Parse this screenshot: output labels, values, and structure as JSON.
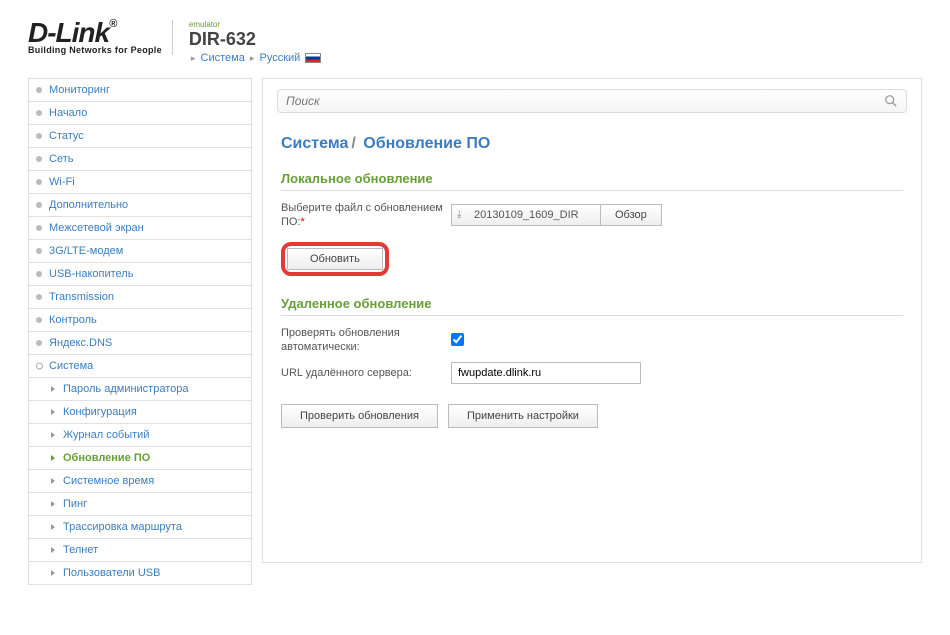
{
  "header": {
    "logo_main": "D-Link",
    "logo_sub": "Building Networks for People",
    "emulator": "emulator",
    "model": "DIR-632",
    "breadcrumb1": "Система",
    "breadcrumb2": "Русский"
  },
  "search": {
    "placeholder": "Поиск"
  },
  "nav": {
    "monitoring": "Мониторинг",
    "start": "Начало",
    "status": "Статус",
    "network": "Сеть",
    "wifi": "Wi-Fi",
    "additional": "Дополнительно",
    "firewall": "Межсетевой экран",
    "modem": "3G/LTE-модем",
    "usb": "USB-накопитель",
    "transmission": "Transmission",
    "control": "Контроль",
    "yandex": "Яндекс.DNS",
    "system": "Система",
    "sys_password": "Пароль администратора",
    "sys_config": "Конфигурация",
    "sys_log": "Журнал событий",
    "sys_update": "Обновление ПО",
    "sys_time": "Системное время",
    "sys_ping": "Пинг",
    "sys_trace": "Трассировка маршрута",
    "sys_telnet": "Телнет",
    "sys_users": "Пользователи USB"
  },
  "page": {
    "crumb1": "Система",
    "crumb2": "Обновление ПО"
  },
  "local": {
    "title": "Локальное обновление",
    "file_label": "Выберите файл с обновлением ПО:",
    "file_value": "20130109_1609_DIR",
    "browse": "Обзор",
    "update": "Обновить"
  },
  "remote": {
    "title": "Удаленное обновление",
    "auto_label": "Проверять обновления автоматически:",
    "url_label": "URL удалённого сервера:",
    "url_value": "fwupdate.dlink.ru"
  },
  "actions": {
    "check": "Проверить обновления",
    "apply": "Применить настройки"
  }
}
